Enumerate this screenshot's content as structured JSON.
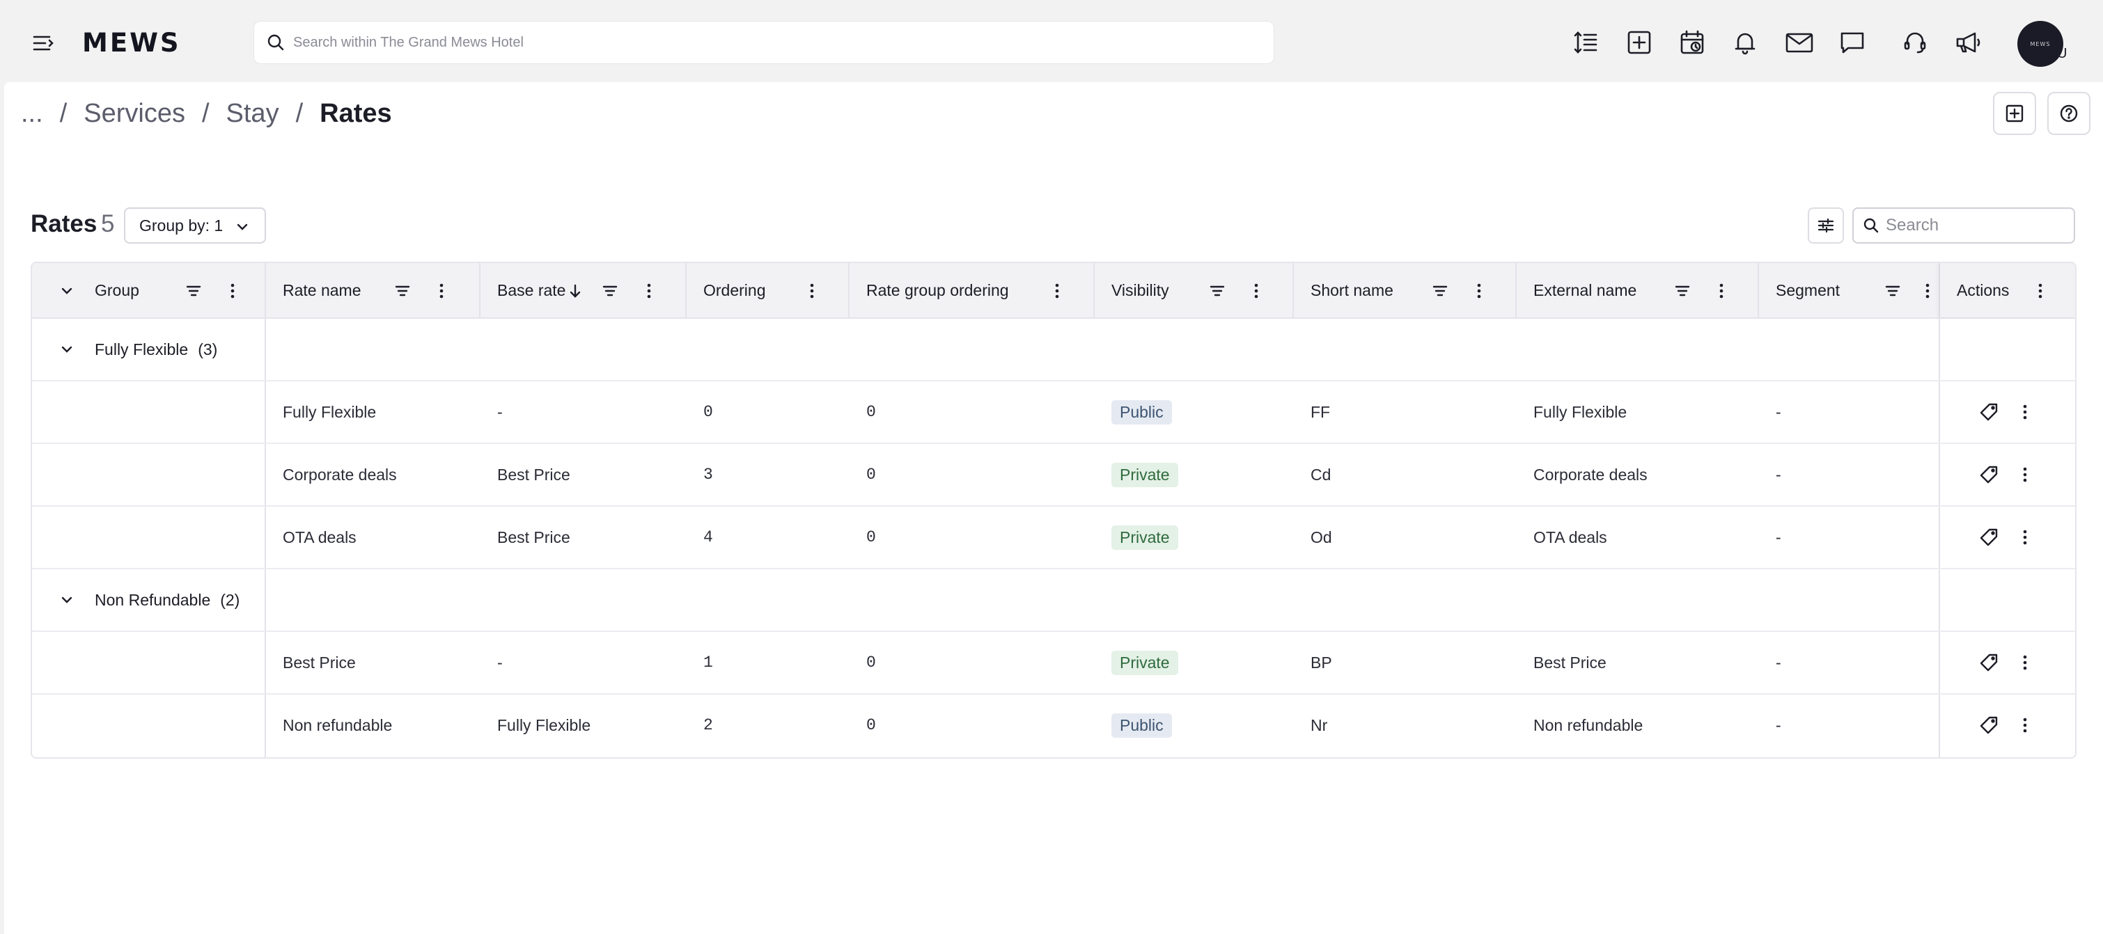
{
  "topbar": {
    "logo": "MEWS",
    "search_placeholder": "Search within The Grand Mews Hotel",
    "icons": [
      "menu-icon",
      "text-height-icon",
      "add-box-icon",
      "calendar-clock-icon",
      "bell-icon",
      "mail-icon",
      "chat-icon",
      "support-headset-icon",
      "megaphone-icon"
    ],
    "avatar_text": "MEWS",
    "avatar_badge": "U"
  },
  "breadcrumb": {
    "ellipsis": "...",
    "separator": "/",
    "items": [
      "Services",
      "Stay"
    ],
    "current": "Rates"
  },
  "toolbar": {
    "title": "Rates",
    "count": "5",
    "group_by_label": "Group by: 1",
    "search_placeholder": "Search"
  },
  "table": {
    "columns": {
      "group": "Group",
      "rate_name": "Rate name",
      "base_rate": "Base rate",
      "ordering": "Ordering",
      "rate_group_ordering": "Rate group ordering",
      "visibility": "Visibility",
      "short_name": "Short name",
      "external_name": "External name",
      "segment": "Segment",
      "actions": "Actions"
    },
    "groups": [
      {
        "name": "Fully Flexible",
        "count": "(3)"
      },
      {
        "name": "Non Refundable",
        "count": "(2)"
      }
    ],
    "rows": [
      {
        "rate_name": "Fully Flexible",
        "base_rate": "-",
        "ordering": "0",
        "rate_group_ordering": "0",
        "visibility": "Public",
        "short_name": "FF",
        "external_name": "Fully Flexible",
        "segment": "-"
      },
      {
        "rate_name": "Corporate deals",
        "base_rate": "Best Price",
        "ordering": "3",
        "rate_group_ordering": "0",
        "visibility": "Private",
        "short_name": "Cd",
        "external_name": "Corporate deals",
        "segment": "-"
      },
      {
        "rate_name": "OTA deals",
        "base_rate": "Best Price",
        "ordering": "4",
        "rate_group_ordering": "0",
        "visibility": "Private",
        "short_name": "Od",
        "external_name": "OTA deals",
        "segment": "-"
      },
      {
        "rate_name": "Best Price",
        "base_rate": "-",
        "ordering": "1",
        "rate_group_ordering": "0",
        "visibility": "Private",
        "short_name": "BP",
        "external_name": "Best Price",
        "segment": "-"
      },
      {
        "rate_name": "Non refundable",
        "base_rate": "Fully Flexible",
        "ordering": "2",
        "rate_group_ordering": "0",
        "visibility": "Public",
        "short_name": "Nr",
        "external_name": "Non refundable",
        "segment": "-"
      }
    ]
  },
  "colors": {
    "public_badge_bg": "#e5eaf2",
    "private_badge_bg": "#e4f1e6",
    "avatar_bg": "#1a1b26"
  }
}
